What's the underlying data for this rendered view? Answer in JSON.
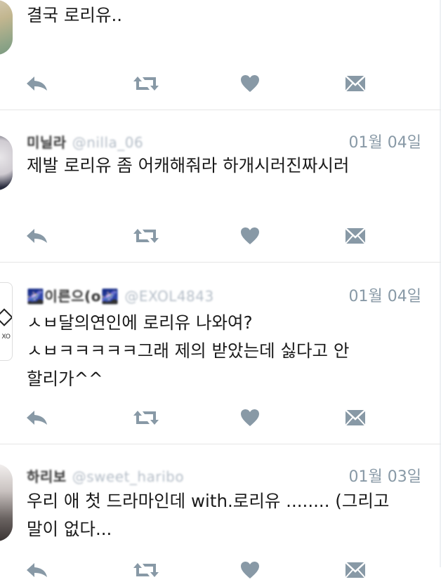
{
  "tweets": [
    {
      "handle_nick": "",
      "handle_id": "",
      "date": "",
      "text": "결국 로리유.."
    },
    {
      "handle_nick": "미닐라",
      "handle_id": "@nilla_06",
      "date": "01월 04일",
      "text": "제발 로리유 좀 어캐해줘라 하개시러진짜시러"
    },
    {
      "handle_nick": "🌌이른으(o🌌",
      "handle_id": "@EXOL4843",
      "date": "01월 04일",
      "text": "ㅅㅂ달의연인에 로리유 나와여?\nㅅㅂㅋㅋㅋㅋㅋ그래 제의 받았는데 싫다고 안\n할리가^^"
    },
    {
      "handle_nick": "하리보",
      "handle_id": "@sweet_haribo",
      "date": "01월 03일",
      "text": "우리 애 첫 드라마인데 with.로리유 ........ (그리고\n말이 없다..."
    }
  ],
  "icons": {
    "reply": "reply-icon",
    "retweet": "retweet-icon",
    "like": "heart-icon",
    "message": "envelope-icon"
  },
  "colors": {
    "icon": "#8899a6",
    "date": "#8899a6",
    "text": "#1a1a1a",
    "divider": "#e6e6e6"
  }
}
